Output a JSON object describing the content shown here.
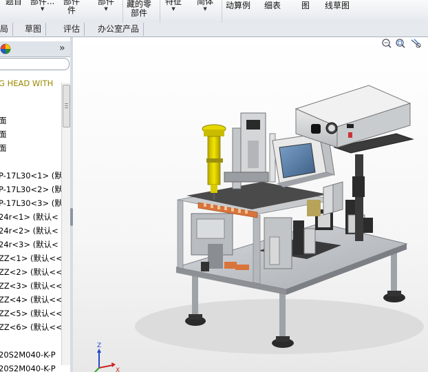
{
  "ribbon": {
    "buttons": [
      {
        "label": "题目",
        "caret": false
      },
      {
        "label": "部件...",
        "caret": true
      },
      {
        "label": "已存部件",
        "caret": false
      },
      {
        "label": "部件",
        "caret": true
      },
      {
        "label": "藏的零部件",
        "caret": false
      },
      {
        "label": "特征",
        "caret": true
      },
      {
        "label": "简体",
        "caret": true
      },
      {
        "label": "动算例",
        "caret": false
      },
      {
        "label": "细表",
        "caret": false
      },
      {
        "label": "图",
        "caret": false
      },
      {
        "label": "线草图",
        "caret": false
      }
    ],
    "row2": [
      "部件",
      "件",
      "藏的零",
      "部件"
    ]
  },
  "tabs": [
    "局",
    "草图",
    "评估",
    "办公室产品"
  ],
  "left_panel": {
    "collapse_label": "»",
    "tree_items": [
      {
        "label": "G HEAD WITH",
        "color": "#9a8a00"
      },
      {
        "label": "",
        "color": "#000000"
      },
      {
        "label": "面",
        "color": "#000000"
      },
      {
        "label": "面",
        "color": "#000000"
      },
      {
        "label": "面",
        "color": "#000000"
      },
      {
        "label": "",
        "color": "#000000"
      },
      {
        "label": "P-17L30<1> (默",
        "color": "#000000"
      },
      {
        "label": "P-17L30<2> (默",
        "color": "#000000"
      },
      {
        "label": "P-17L30<3> (默",
        "color": "#000000"
      },
      {
        "label": "24r<1> (默认<",
        "color": "#000000"
      },
      {
        "label": "24r<2> (默认<",
        "color": "#000000"
      },
      {
        "label": "24r<3> (默认<",
        "color": "#000000"
      },
      {
        "label": "ZZ<1> (默认<<",
        "color": "#000000"
      },
      {
        "label": "ZZ<2> (默认<<",
        "color": "#000000"
      },
      {
        "label": "ZZ<3> (默认<<",
        "color": "#000000"
      },
      {
        "label": "ZZ<4> (默认<<",
        "color": "#000000"
      },
      {
        "label": "ZZ<5> (默认<<",
        "color": "#000000"
      },
      {
        "label": "ZZ<6> (默认<<",
        "color": "#000000"
      },
      {
        "label": "20S2M040-K-P",
        "color": "#000000"
      },
      {
        "label": "20S2M040-K-P",
        "color": "#000000"
      },
      {
        "label": "20S2M040-K-P",
        "color": "#000000"
      }
    ]
  },
  "viewport": {
    "triad_labels": {
      "z": "Z",
      "x": "X"
    },
    "toolbar_icons": [
      "zoom-fit-icon",
      "zoom-area-icon",
      "rotate-view-icon"
    ]
  },
  "colors": {
    "accent_yellow": "#e6d800",
    "frame_gray": "#b5b9bd",
    "orange_parts": "#d9743a",
    "screen_blue": "#5a7ca8"
  }
}
